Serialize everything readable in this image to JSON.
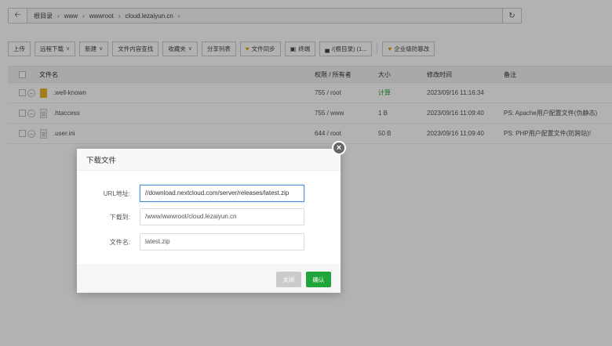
{
  "pathbar": {
    "crumbs": [
      "根目录",
      "www",
      "wwwroot",
      "cloud.lezaiyun.cn"
    ]
  },
  "toolbar": {
    "upload": "上传",
    "remote_download": "远程下载",
    "new": "新建",
    "content_search": "文件内容查找",
    "favorites": "收藏夹",
    "share_list": "分享列表",
    "file_sync": "文件同步",
    "terminal": "终端",
    "disk": "/(根目录) (1...",
    "tamper_proof": "企业级防篡改"
  },
  "table": {
    "headers": {
      "name": "文件名",
      "perm": "权限 / 所有者",
      "size": "大小",
      "time": "修改时间",
      "note": "备注"
    },
    "rows": [
      {
        "name": ".well-known",
        "perm": "755 / root",
        "size": "计算",
        "time": "2023/09/16 11:16:34",
        "note": ""
      },
      {
        "name": ".htaccess",
        "perm": "755 / www",
        "size": "1 B",
        "time": "2023/09/16 11:09:40",
        "note": "PS: Apache用户配置文件(伪静态)"
      },
      {
        "name": ".user.ini",
        "perm": "644 / root",
        "size": "50 B",
        "time": "2023/09/16 11:09:40",
        "note": "PS: PHP用户配置文件(防跨站)!"
      }
    ]
  },
  "dialog": {
    "title": "下载文件",
    "url_label": "URL地址:",
    "url_value": "//download.nextcloud.com/server/releases/latest.zip",
    "dest_label": "下载到:",
    "dest_value": "/www/wwwroot/cloud.lezaiyun.cn",
    "filename_label": "文件名:",
    "filename_value": "latest.zip",
    "cancel": "关闭",
    "ok": "确认"
  },
  "icons": {
    "back": "arrow-left-icon",
    "refresh": "refresh-icon",
    "close": "close-icon"
  },
  "colors": {
    "accent": "#20a53a",
    "folder": "#e7b528",
    "focus": "#4a90d9"
  }
}
